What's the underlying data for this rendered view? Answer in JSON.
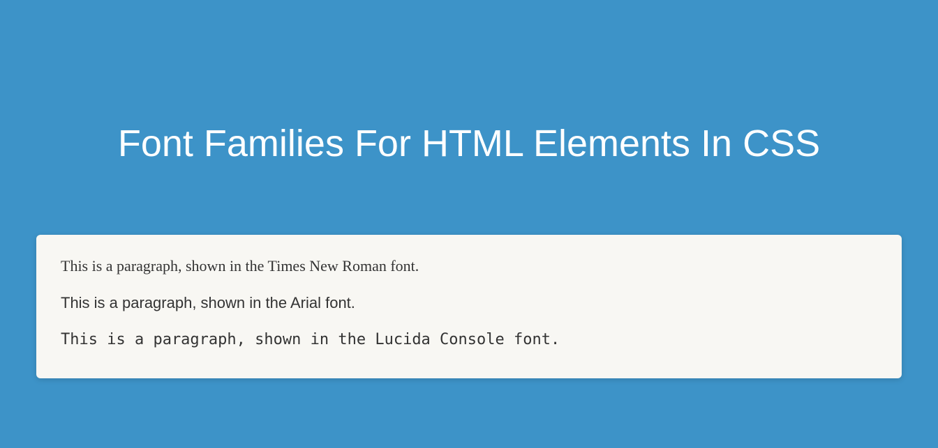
{
  "heading": "Font Families For HTML Elements In CSS",
  "paragraphs": {
    "p1": "This is a paragraph, shown in the Times New Roman font.",
    "p2": "This is a paragraph, shown in the Arial font.",
    "p3": "This is a paragraph, shown in the Lucida Console font."
  }
}
